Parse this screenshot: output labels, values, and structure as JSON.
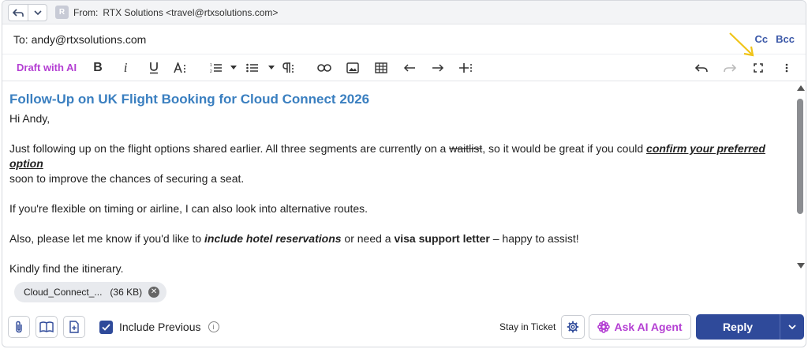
{
  "header": {
    "avatar_letter": "R",
    "from_label": "From:",
    "from_value": "RTX Solutions <travel@rtxsolutions.com>",
    "to_text": "To: andy@rtxsolutions.com",
    "cc_label": "Cc",
    "bcc_label": "Bcc"
  },
  "toolbar": {
    "draft_ai_label": "Draft with AI"
  },
  "email": {
    "subject": "Follow-Up on UK Flight Booking for Cloud Connect 2026",
    "greeting": "Hi Andy,",
    "p1_a": "Just following up on the flight options shared earlier. All three segments are currently on a ",
    "p1_strike": "waitlist",
    "p1_b": ", so it would be great if you could ",
    "p1_emph": "confirm your preferred option",
    "p1_c": "soon to improve the chances of securing a seat.",
    "p2": "If you're flexible on timing or airline, I can also look into alternative routes.",
    "p3_a": "Also, please let me know if you'd like to ",
    "p3_emph1": "include hotel reservations",
    "p3_b": " or need a ",
    "p3_emph2": "visa support letter",
    "p3_c": " – happy to assist!",
    "p4": "Kindly find the itinerary."
  },
  "attachment": {
    "name": "Cloud_Connect_...",
    "size": "(36 KB)"
  },
  "footer": {
    "include_previous_label": "Include Previous",
    "include_previous_checked": true,
    "stay_in_ticket_label": "Stay in Ticket",
    "ask_ai_label": "Ask AI Agent",
    "reply_label": "Reply"
  },
  "colors": {
    "accent": "#2f4a9a",
    "ai_purple": "#b43fd3",
    "subject_blue": "#3a7fc0",
    "annotation_arrow": "#f0c419"
  }
}
